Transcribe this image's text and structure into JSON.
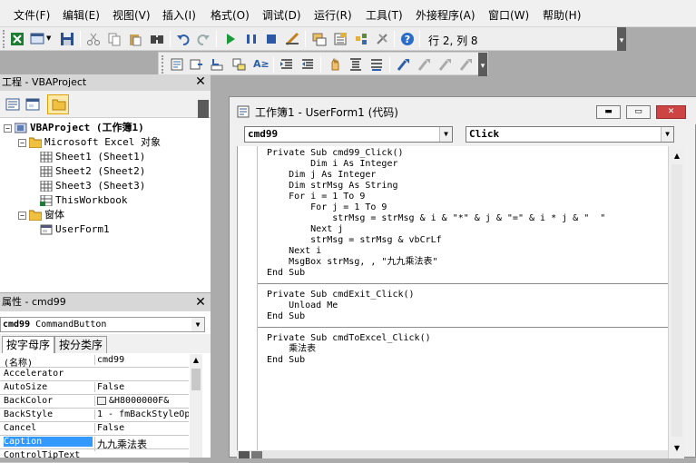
{
  "menu": [
    "文件(F)",
    "编辑(E)",
    "视图(V)",
    "插入(I)",
    "格式(O)",
    "调试(D)",
    "运行(R)",
    "工具(T)",
    "外接程序(A)",
    "窗口(W)",
    "帮助(H)"
  ],
  "toolbar": {
    "position": "行 2, 列 8",
    "icons": [
      "excel-icon",
      "insert-userform-icon",
      "save-icon",
      "cut-icon",
      "copy-icon",
      "paste-icon",
      "find-icon",
      "undo-icon",
      "redo-icon",
      "run-icon",
      "break-icon",
      "reset-icon",
      "design-mode-icon",
      "project-explorer-icon",
      "properties-icon",
      "object-browser-icon",
      "toolbox-icon",
      "help-icon"
    ]
  },
  "edit_toolbar": {
    "icons": [
      "list-properties-icon",
      "list-constants-icon",
      "quick-info-icon",
      "parameter-info-icon",
      "complete-word-icon",
      "indent-icon",
      "outdent-icon",
      "toggle-breakpoint-icon",
      "comment-block-icon",
      "uncomment-block-icon",
      "toggle-bookmark-icon",
      "next-bookmark-icon",
      "prev-bookmark-icon",
      "clear-bookmarks-icon"
    ]
  },
  "project": {
    "title": "工程 - VBAProject",
    "nodes": [
      {
        "label": "VBAProject (工作簿1)",
        "bold": true,
        "icon": "vba-project-icon"
      },
      {
        "label": "Microsoft Excel 对象",
        "icon": "folder-icon"
      },
      {
        "label": "Sheet1 (Sheet1)",
        "icon": "sheet-icon"
      },
      {
        "label": "Sheet2 (Sheet2)",
        "icon": "sheet-icon"
      },
      {
        "label": "Sheet3 (Sheet3)",
        "icon": "sheet-icon"
      },
      {
        "label": "ThisWorkbook",
        "icon": "workbook-icon"
      },
      {
        "label": "窗体",
        "icon": "folder-icon"
      },
      {
        "label": "UserForm1",
        "icon": "userform-icon"
      }
    ]
  },
  "properties": {
    "title": "属性 - cmd99",
    "object_name": "cmd99",
    "object_type": "CommandButton",
    "tabs": [
      "按字母序",
      "按分类序"
    ],
    "rows": [
      {
        "name": "(名称)",
        "value": "cmd99"
      },
      {
        "name": "Accelerator",
        "value": ""
      },
      {
        "name": "AutoSize",
        "value": "False"
      },
      {
        "name": "BackColor",
        "value": "&H8000000F&"
      },
      {
        "name": "BackStyle",
        "value": "1 - fmBackStyleOp"
      },
      {
        "name": "Cancel",
        "value": "False"
      },
      {
        "name": "Caption",
        "value": "九九乘法表"
      },
      {
        "name": "ControlTipText",
        "value": ""
      }
    ]
  },
  "code_window": {
    "title": "工作簿1 - UserForm1 (代码)",
    "object_combo": "cmd99",
    "procedure_combo": "Click",
    "lines": [
      "Private Sub cmd99_Click()",
      "        Dim i As Integer",
      "    Dim j As Integer",
      "    Dim strMsg As String",
      "    For i = 1 To 9",
      "        For j = 1 To 9",
      "            strMsg = strMsg & i & \"*\" & j & \"=\" & i * j & \"  \"",
      "        Next j",
      "        strMsg = strMsg & vbCrLf",
      "    Next i",
      "    MsgBox strMsg, , \"九九乘法表\"",
      "End Sub",
      "",
      "Private Sub cmdExit_Click()",
      "    Unload Me",
      "End Sub",
      "",
      "Private Sub cmdToExcel_Click()",
      "    乘法表",
      "End Sub"
    ]
  }
}
